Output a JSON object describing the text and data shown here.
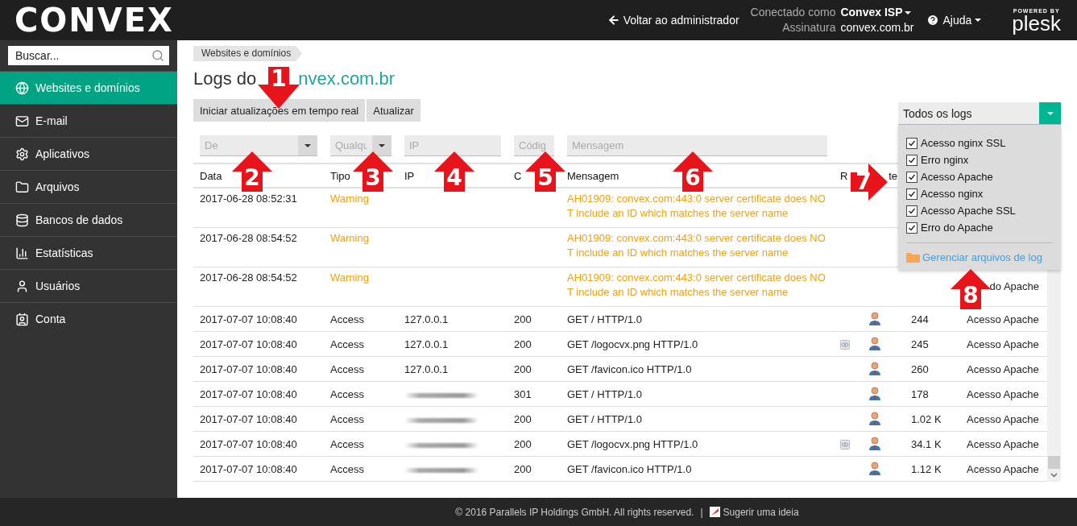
{
  "header": {
    "logo": "CONVEX",
    "back_link": "Voltar ao administrador",
    "connected_label": "Conectado como",
    "connected_user": "Convex ISP",
    "subscription_label": "Assinatura",
    "subscription": "convex.com.br",
    "help": "Ajuda",
    "powered_by": "POWERED BY",
    "powered_brand": "plesk"
  },
  "sidebar": {
    "search": {
      "placeholder": "Buscar..."
    },
    "items": [
      {
        "label": "Websites e domínios",
        "selected": true
      },
      {
        "label": "E-mail",
        "selected": false
      },
      {
        "label": "Aplicativos",
        "selected": false
      },
      {
        "label": "Arquivos",
        "selected": false
      },
      {
        "label": "Bancos de dados",
        "selected": false
      },
      {
        "label": "Estatísticas",
        "selected": false
      },
      {
        "label": "Usuários",
        "selected": false
      },
      {
        "label": "Conta",
        "selected": false
      }
    ]
  },
  "breadcrumb": [
    "Websites e domínios"
  ],
  "title": {
    "prefix": "Logs do",
    "domain": "nvex.com.br"
  },
  "toolbar": [
    "Iniciar atualizações em tempo real",
    "Atualizar"
  ],
  "filters": [
    {
      "placeholder": "De",
      "dropdown": true
    },
    {
      "placeholder": "Qualqu",
      "dropdown": true
    },
    {
      "placeholder": "IP",
      "dropdown": false
    },
    {
      "placeholder": "Códig",
      "dropdown": false
    },
    {
      "placeholder": "Mensagem",
      "dropdown": false
    }
  ],
  "table": {
    "columns": [
      "Data",
      "Tipo",
      "IP",
      "C",
      "Mensagem",
      "R",
      "te"
    ],
    "rows": [
      {
        "kind": "warning",
        "date": "2017-06-28 08:52:31",
        "type": "Warning",
        "message_lines": [
          "AH01909: convex.com:443:0 server certificate does NO",
          "T include an ID which matches the server name"
        ]
      },
      {
        "kind": "warning",
        "date": "2017-06-28 08:54:52",
        "type": "Warning",
        "message_lines": [
          "AH01909: convex.com:443:0 server certificate does NO",
          "T include an ID which matches the server name"
        ]
      },
      {
        "kind": "warning",
        "date": "2017-06-28 08:54:52",
        "type": "Warning",
        "message_lines": [
          "AH01909: convex.com:443:0 server certificate does NO",
          "T include an ID which matches the server name"
        ],
        "source": "do Apache"
      },
      {
        "kind": "access",
        "date": "2017-07-07 10:08:40",
        "type": "Access",
        "ip": "127.0.0.1",
        "ip_blurred": false,
        "code": "200",
        "message": "GET / HTTP/1.0",
        "preview": false,
        "size": "244",
        "source": "Acesso Apache"
      },
      {
        "kind": "access",
        "date": "2017-07-07 10:08:40",
        "type": "Access",
        "ip": "127.0.0.1",
        "ip_blurred": false,
        "code": "200",
        "message": "GET /logocvx.png HTTP/1.0",
        "preview": true,
        "size": "245",
        "source": "Acesso Apache"
      },
      {
        "kind": "access",
        "date": "2017-07-07 10:08:40",
        "type": "Access",
        "ip": "127.0.0.1",
        "ip_blurred": false,
        "code": "200",
        "message": "GET /favicon.ico HTTP/1.0",
        "preview": false,
        "size": "260",
        "source": "Acesso Apache"
      },
      {
        "kind": "access",
        "date": "2017-07-07 10:08:40",
        "type": "Access",
        "ip_blurred": true,
        "code": "301",
        "message": "GET / HTTP/1.0",
        "preview": false,
        "size": "178",
        "source": "Acesso Apache"
      },
      {
        "kind": "access",
        "date": "2017-07-07 10:08:40",
        "type": "Access",
        "ip_blurred": true,
        "code": "200",
        "message": "GET / HTTP/1.0",
        "preview": false,
        "size": "1.02 K",
        "source": "Acesso Apache"
      },
      {
        "kind": "access",
        "date": "2017-07-07 10:08:40",
        "type": "Access",
        "ip_blurred": true,
        "code": "200",
        "message": "GET /logocvx.png HTTP/1.0",
        "preview": true,
        "size": "34.1 K",
        "source": "Acesso Apache"
      },
      {
        "kind": "access",
        "date": "2017-07-07 10:08:40",
        "type": "Access",
        "ip_blurred": true,
        "code": "200",
        "message": "GET /favicon.ico HTTP/1.0",
        "preview": false,
        "size": "1.12 K",
        "source": "Acesso Apache"
      }
    ]
  },
  "log_selector": {
    "value": "Todos os logs",
    "expanded": true,
    "options": [
      {
        "label": "Acesso nginx SSL",
        "checked": true
      },
      {
        "label": "Erro nginx",
        "checked": true
      },
      {
        "label": "Acesso Apache",
        "checked": true
      },
      {
        "label": "Acesso nginx",
        "checked": true
      },
      {
        "label": "Acesso Apache SSL",
        "checked": true
      },
      {
        "label": "Erro do Apache",
        "checked": true
      }
    ],
    "manage_link": "Gerenciar arquivos de log"
  },
  "annotations": [
    {
      "number": "1",
      "kind": "down"
    },
    {
      "number": "2",
      "kind": "up"
    },
    {
      "number": "3",
      "kind": "up"
    },
    {
      "number": "4",
      "kind": "up"
    },
    {
      "number": "5",
      "kind": "up"
    },
    {
      "number": "6",
      "kind": "up"
    },
    {
      "number": "7",
      "kind": "right"
    },
    {
      "number": "8",
      "kind": "up"
    }
  ],
  "footer": {
    "copyright": "© 2016 Parallels IP Holdings GmbH. All rights reserved.",
    "separator": "|",
    "suggest": "Sugerir uma ideia"
  }
}
